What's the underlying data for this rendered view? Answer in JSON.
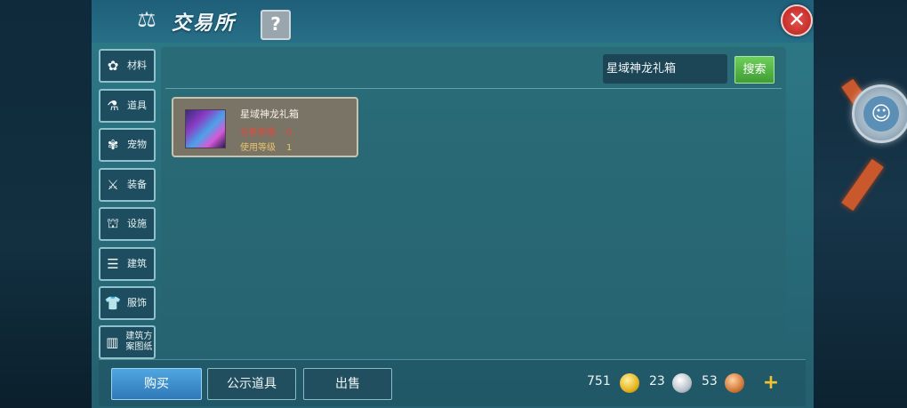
{
  "window": {
    "title": "交易所",
    "help_label": "?",
    "close_label": "✕"
  },
  "sidebar": {
    "items": [
      {
        "label": "材料",
        "icon": "materials-icon",
        "glyph": "✿"
      },
      {
        "label": "道具",
        "icon": "flask-icon",
        "glyph": "⚗"
      },
      {
        "label": "宠物",
        "icon": "paw-icon",
        "glyph": "✾"
      },
      {
        "label": "装备",
        "icon": "sword-icon",
        "glyph": "⚔"
      },
      {
        "label": "设施",
        "icon": "facility-icon",
        "glyph": "⛫"
      },
      {
        "label": "建筑",
        "icon": "building-icon",
        "glyph": "☰"
      },
      {
        "label": "服饰",
        "icon": "clothing-icon",
        "glyph": "👕"
      },
      {
        "label": "建筑方案图纸",
        "icon": "blueprint-icon",
        "glyph": "▥"
      }
    ]
  },
  "search": {
    "value": "星域神龙礼箱",
    "button_label": "搜索"
  },
  "items": [
    {
      "name": "星域神龙礼箱",
      "on_sale_label": "在售数量",
      "on_sale_value": "0",
      "level_label": "使用等级",
      "level_value": "1"
    }
  ],
  "bottom": {
    "buy_label": "购买",
    "public_label": "公示道具",
    "sell_label": "出售",
    "gold": "751",
    "silver": "23",
    "bronze": "53",
    "add_label": "+"
  },
  "colors": {
    "accent": "#2f78b8",
    "search_green": "#3f9d35",
    "close_red": "#c42f2b"
  }
}
